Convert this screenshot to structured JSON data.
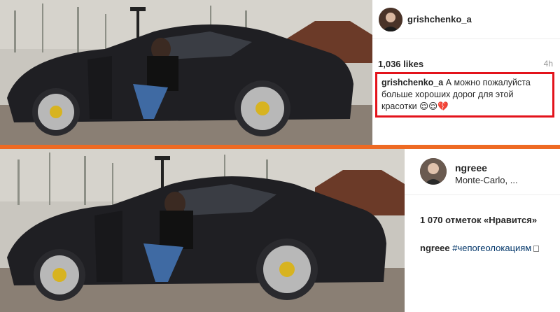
{
  "top_post": {
    "username": "grishchenko_a",
    "likes": "1,036 likes",
    "time": "4h",
    "caption_user": "grishchenko_a",
    "caption_text": "А можно пожалуйста больше хороших дорог для этой красотки 😌😌💔",
    "highlight_color": "#e3131b"
  },
  "bottom_post": {
    "username": "ngreee",
    "location": "Monte-Carlo, ...",
    "likes": "1 070 отметок «Нравится»",
    "caption_user": "ngreee",
    "hashtag": "#чепогеолокациям"
  },
  "divider_color": "#ee6a23"
}
